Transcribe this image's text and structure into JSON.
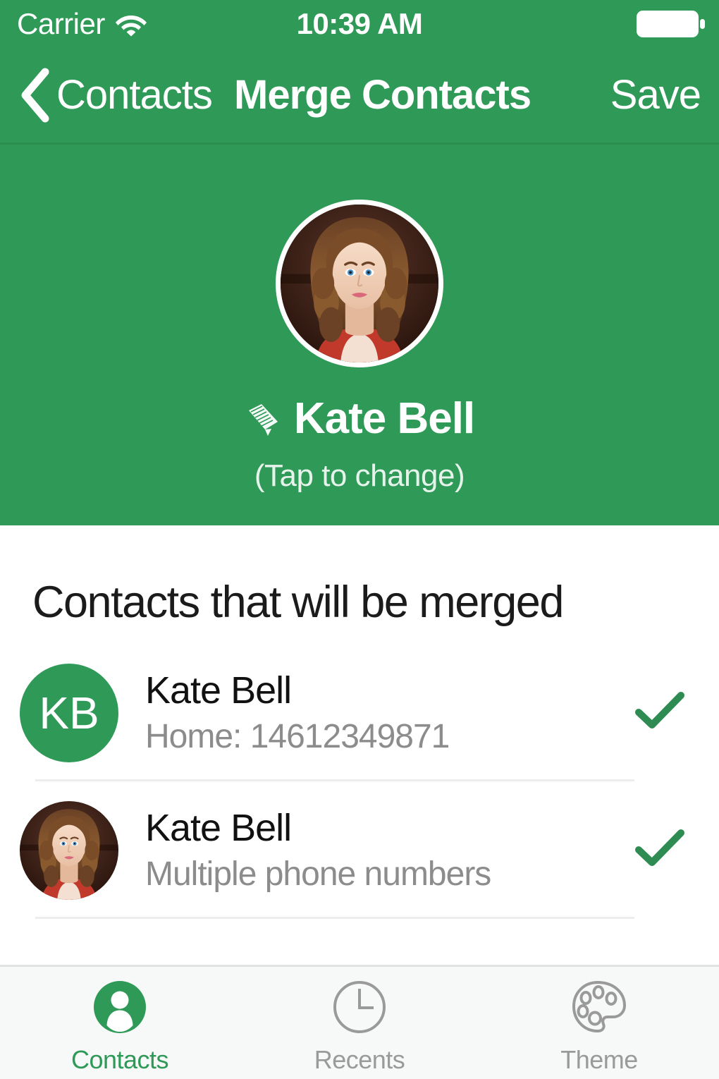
{
  "theme": {
    "accent": "#2F9A58",
    "nav_border": "#2B8E51",
    "tabbar_bg": "#F7F8F8",
    "separator": "#EDEDED",
    "muted_text": "#8C8C8C",
    "inactive_tab": "#9A9A9A"
  },
  "statusbar": {
    "carrier": "Carrier",
    "wifi_icon": "wifi-icon",
    "time": "10:39 AM",
    "battery_icon": "battery-full-icon"
  },
  "navbar": {
    "back_icon": "chevron-left-icon",
    "back_label": "Contacts",
    "title": "Merge Contacts",
    "save_label": "Save"
  },
  "hero": {
    "avatar_icon": "contact-photo-avatar",
    "edit_icon": "pencil-icon",
    "name": "Kate Bell",
    "hint": "(Tap to change)"
  },
  "main": {
    "section_title": "Contacts that will be merged",
    "rows": [
      {
        "avatar_type": "initials",
        "initials": "KB",
        "name": "Kate Bell",
        "detail": "Home: 14612349871",
        "checked": true,
        "check_icon": "checkmark-icon"
      },
      {
        "avatar_type": "photo",
        "initials": "",
        "name": "Kate Bell",
        "detail": "Multiple phone numbers",
        "checked": true,
        "check_icon": "checkmark-icon"
      }
    ]
  },
  "tabbar": {
    "tabs": [
      {
        "label": "Contacts",
        "icon": "person-circle-icon",
        "active": true
      },
      {
        "label": "Recents",
        "icon": "clock-icon",
        "active": false
      },
      {
        "label": "Theme",
        "icon": "palette-icon",
        "active": false
      }
    ]
  }
}
